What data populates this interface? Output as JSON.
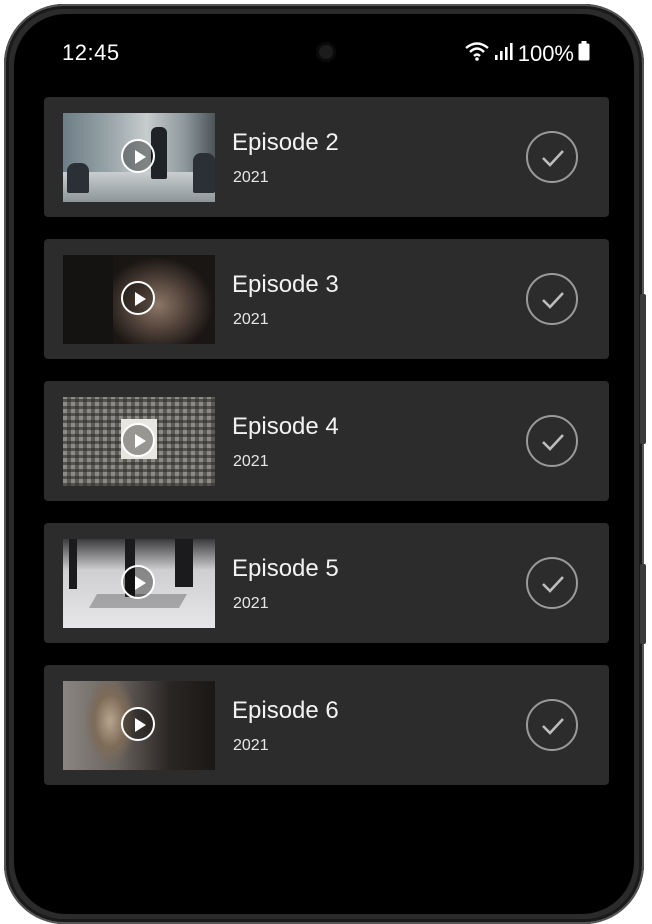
{
  "status_bar": {
    "time": "12:45",
    "battery": "100%",
    "icons": [
      "wifi-icon",
      "signal-icon",
      "battery-icon"
    ]
  },
  "episodes": [
    {
      "title": "Episode 2",
      "year": "2021",
      "thumbnail": "office-meeting-thumbnail",
      "watched": true
    },
    {
      "title": "Episode 3",
      "year": "2021",
      "thumbnail": "man-portrait-thumbnail",
      "watched": true
    },
    {
      "title": "Episode 4",
      "year": "2021",
      "thumbnail": "skyscrapers-thumbnail",
      "watched": true
    },
    {
      "title": "Episode 5",
      "year": "2021",
      "thumbnail": "people-walking-thumbnail",
      "watched": true
    },
    {
      "title": "Episode 6",
      "year": "2021",
      "thumbnail": "woman-portrait-thumbnail",
      "watched": true
    }
  ],
  "colors": {
    "background": "#000000",
    "card": "#2c2c2c",
    "text": "#f2f2f2",
    "check_ring": "#9a9a9a"
  }
}
